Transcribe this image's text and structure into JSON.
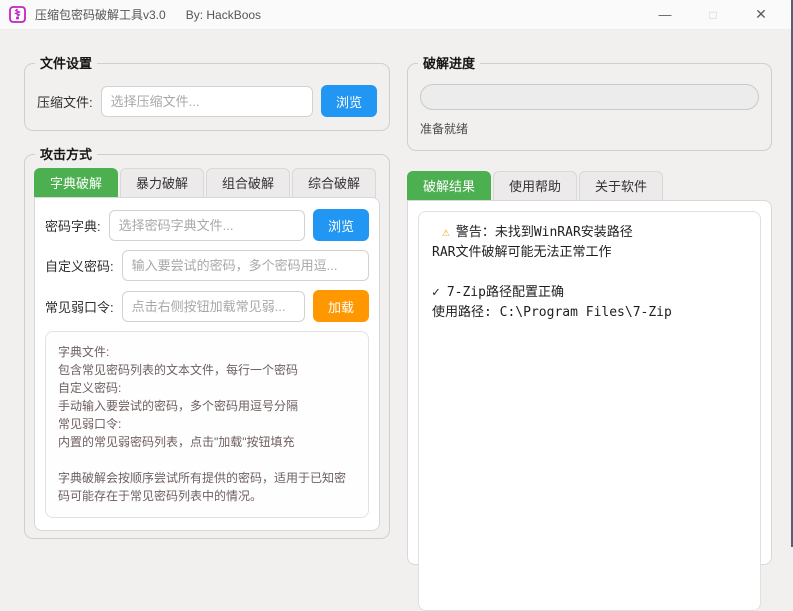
{
  "window": {
    "title": "压缩包密码破解工具v3.0",
    "byline": "By: HackBoos",
    "controls": {
      "minimize": "—",
      "maximize": "□",
      "close": "✕"
    }
  },
  "file_settings": {
    "legend": "文件设置",
    "archive_label": "压缩文件:",
    "archive_placeholder": "选择压缩文件...",
    "browse_label": "浏览"
  },
  "attack": {
    "legend": "攻击方式",
    "tabs": [
      {
        "label": "字典破解"
      },
      {
        "label": "暴力破解"
      },
      {
        "label": "组合破解"
      },
      {
        "label": "综合破解"
      }
    ],
    "dict_label": "密码字典:",
    "dict_placeholder": "选择密码字典文件...",
    "dict_browse_label": "浏览",
    "custom_label": "自定义密码:",
    "custom_placeholder": "输入要尝试的密码，多个密码用逗...",
    "weak_label": "常见弱口令:",
    "weak_placeholder": "点击右侧按钮加载常见弱...",
    "load_label": "加载",
    "description": "字典文件:\n包含常见密码列表的文本文件，每行一个密码\n自定义密码:\n手动输入要尝试的密码，多个密码用逗号分隔\n常见弱口令:\n内置的常见弱密码列表，点击\"加载\"按钮填充\n\n字典破解会按顺序尝试所有提供的密码，适用于已知密码可能存在于常见密码列表中的情况。"
  },
  "progress": {
    "legend": "破解进度",
    "status": "准备就绪"
  },
  "results": {
    "tabs": [
      {
        "label": "破解结果"
      },
      {
        "label": "使用帮助"
      },
      {
        "label": "关于软件"
      }
    ],
    "lines": [
      {
        "text": "警告：未找到WinRAR安装路径"
      },
      {
        "text": "RAR文件破解可能无法正常工作"
      },
      {
        "text": ""
      },
      {
        "text": "7-Zip路径配置正确"
      },
      {
        "text": "使用路径: C:\\Program Files\\7-Zip"
      }
    ]
  },
  "icons": {
    "warning": "⚠",
    "check": "✓"
  },
  "colors": {
    "accent_green": "#4caf50",
    "accent_blue": "#2196f3",
    "accent_orange": "#ff9800",
    "brand_magenta": "#c224c2",
    "warning_yellow": "#f0a92e",
    "window_bg": "#f1f0ee"
  }
}
